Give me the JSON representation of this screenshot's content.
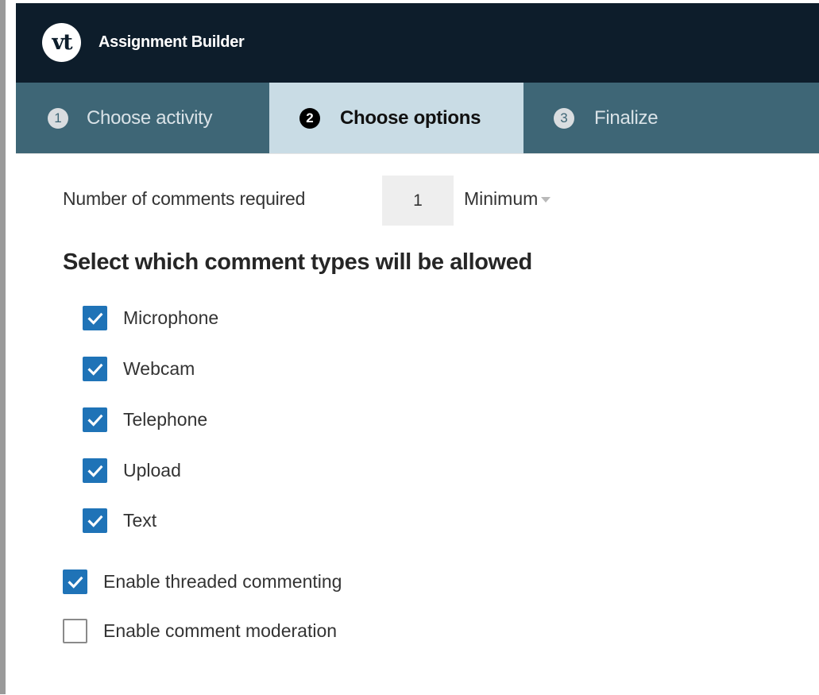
{
  "app": {
    "logo_text": "vt",
    "title": "Assignment Builder"
  },
  "steps": [
    {
      "number": "1",
      "label": "Choose activity",
      "active": false
    },
    {
      "number": "2",
      "label": "Choose options",
      "active": true
    },
    {
      "number": "3",
      "label": "Finalize",
      "active": false
    }
  ],
  "comments": {
    "label": "Number of comments required",
    "value": "1",
    "mode": "Minimum"
  },
  "comment_types": {
    "heading": "Select which comment types will be allowed",
    "options": [
      {
        "label": "Microphone",
        "checked": true
      },
      {
        "label": "Webcam",
        "checked": true
      },
      {
        "label": "Telephone",
        "checked": true
      },
      {
        "label": "Upload",
        "checked": true
      },
      {
        "label": "Text",
        "checked": true
      }
    ]
  },
  "settings": [
    {
      "label": "Enable threaded commenting",
      "checked": true
    },
    {
      "label": "Enable comment moderation",
      "checked": false
    }
  ],
  "colors": {
    "header_bg": "#0d1d2b",
    "stepper_bg": "#3e6676",
    "active_step_bg": "#c9dce5",
    "checkbox_checked": "#1f73b7"
  }
}
